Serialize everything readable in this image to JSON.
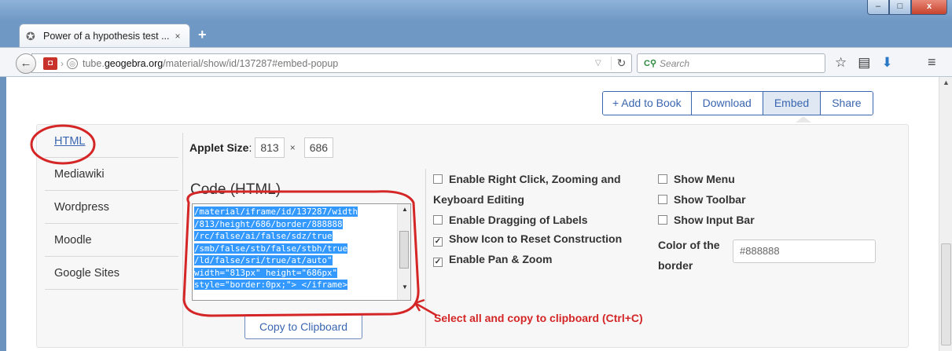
{
  "window": {
    "tab_title": "Power of a hypothesis test ...",
    "tab_close": "×",
    "new_tab": "+",
    "min": "–",
    "max": "□",
    "close": "x"
  },
  "nav": {
    "url_host_pre": "tube.",
    "url_host_bold": "geogebra.org",
    "url_path": "/material/show/id/137287#embed-popup",
    "search_placeholder": "Search"
  },
  "toolbar": {
    "add_to_book": "+ Add to Book",
    "download": "Download",
    "embed": "Embed",
    "share": "Share"
  },
  "sidebar": {
    "items": [
      {
        "label": "HTML"
      },
      {
        "label": "Mediawiki"
      },
      {
        "label": "Wordpress"
      },
      {
        "label": "Moodle"
      },
      {
        "label": "Google Sites"
      }
    ]
  },
  "applet": {
    "label": "Applet Size",
    "colon": ":",
    "width": "813",
    "times": "×",
    "height": "686"
  },
  "code": {
    "title": "Code (HTML)",
    "lines": [
      "/material/iframe/id/137287/width",
      "/813/height/686/border/888888",
      "/rc/false/ai/false/sdz/true",
      "/smb/false/stb/false/stbh/true",
      "/ld/false/sri/true/at/auto\"",
      "width=\"813px\" height=\"686px\"",
      "style=\"border:0px;\"> </iframe>"
    ],
    "copy_button": "Copy to Clipboard"
  },
  "options": {
    "right_click": "Enable Right Click, Zooming and",
    "keyboard": "Keyboard Editing",
    "dragging": "Enable Dragging of Labels",
    "reset_icon": "Show Icon to Reset Construction",
    "pan_zoom": "Enable Pan & Zoom",
    "show_menu": "Show Menu",
    "show_toolbar": "Show Toolbar",
    "show_input_bar": "Show Input Bar",
    "color_label_1": "Color of the",
    "color_label_2": "border",
    "color_value": "#888888"
  },
  "annotation": "Select all and copy to clipboard (Ctrl+C)",
  "colors": {
    "accent": "#3a66b0",
    "selection": "#3399ff",
    "annotation": "#d42626"
  }
}
